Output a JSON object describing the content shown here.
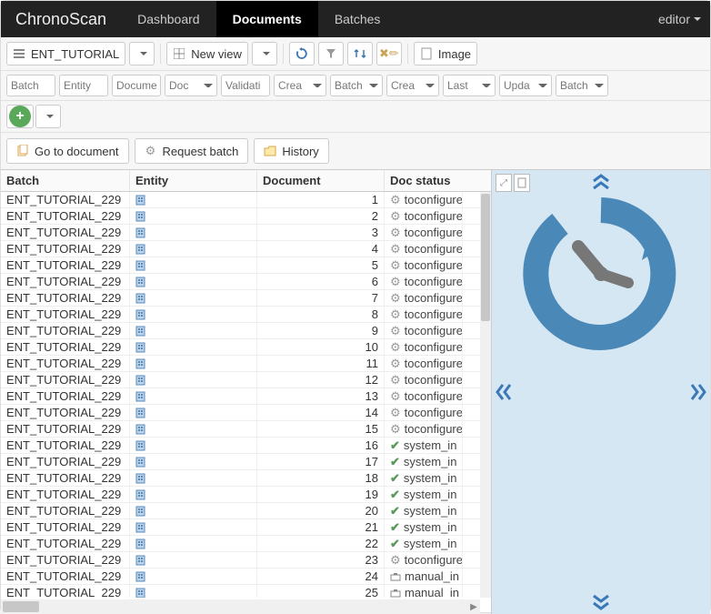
{
  "nav": {
    "brand": "ChronoScan",
    "items": [
      "Dashboard",
      "Documents",
      "Batches"
    ],
    "active_index": 1,
    "user": "editor"
  },
  "toolbar1": {
    "config_label": "ENT_TUTORIAL",
    "view_label": "New view",
    "image_btn": "Image"
  },
  "filters": {
    "f0": "Batch",
    "f1": "Entity",
    "f2": "Docume",
    "f3": "Doc",
    "f4": "Validati",
    "f5": "Crea",
    "f6": "Batch",
    "f7": "Crea",
    "f8": "Last",
    "f9": "Upda",
    "f10": "Batch"
  },
  "actions": {
    "goto": "Go to document",
    "request": "Request batch",
    "history": "History"
  },
  "grid": {
    "headers": {
      "batch": "Batch",
      "entity": "Entity",
      "document": "Document",
      "status": "Doc status"
    },
    "rows": [
      {
        "batch": "ENT_TUTORIAL_229",
        "doc": 1,
        "status": "toconfigure",
        "kind": "cfg"
      },
      {
        "batch": "ENT_TUTORIAL_229",
        "doc": 2,
        "status": "toconfigure",
        "kind": "cfg"
      },
      {
        "batch": "ENT_TUTORIAL_229",
        "doc": 3,
        "status": "toconfigure",
        "kind": "cfg"
      },
      {
        "batch": "ENT_TUTORIAL_229",
        "doc": 4,
        "status": "toconfigure",
        "kind": "cfg"
      },
      {
        "batch": "ENT_TUTORIAL_229",
        "doc": 5,
        "status": "toconfigure",
        "kind": "cfg"
      },
      {
        "batch": "ENT_TUTORIAL_229",
        "doc": 6,
        "status": "toconfigure",
        "kind": "cfg"
      },
      {
        "batch": "ENT_TUTORIAL_229",
        "doc": 7,
        "status": "toconfigure",
        "kind": "cfg"
      },
      {
        "batch": "ENT_TUTORIAL_229",
        "doc": 8,
        "status": "toconfigure",
        "kind": "cfg"
      },
      {
        "batch": "ENT_TUTORIAL_229",
        "doc": 9,
        "status": "toconfigure",
        "kind": "cfg"
      },
      {
        "batch": "ENT_TUTORIAL_229",
        "doc": 10,
        "status": "toconfigure",
        "kind": "cfg"
      },
      {
        "batch": "ENT_TUTORIAL_229",
        "doc": 11,
        "status": "toconfigure",
        "kind": "cfg"
      },
      {
        "batch": "ENT_TUTORIAL_229",
        "doc": 12,
        "status": "toconfigure",
        "kind": "cfg"
      },
      {
        "batch": "ENT_TUTORIAL_229",
        "doc": 13,
        "status": "toconfigure",
        "kind": "cfg"
      },
      {
        "batch": "ENT_TUTORIAL_229",
        "doc": 14,
        "status": "toconfigure",
        "kind": "cfg"
      },
      {
        "batch": "ENT_TUTORIAL_229",
        "doc": 15,
        "status": "toconfigure",
        "kind": "cfg"
      },
      {
        "batch": "ENT_TUTORIAL_229",
        "doc": 16,
        "status": "system_in",
        "kind": "ok"
      },
      {
        "batch": "ENT_TUTORIAL_229",
        "doc": 17,
        "status": "system_in",
        "kind": "ok"
      },
      {
        "batch": "ENT_TUTORIAL_229",
        "doc": 18,
        "status": "system_in",
        "kind": "ok"
      },
      {
        "batch": "ENT_TUTORIAL_229",
        "doc": 19,
        "status": "system_in",
        "kind": "ok"
      },
      {
        "batch": "ENT_TUTORIAL_229",
        "doc": 20,
        "status": "system_in",
        "kind": "ok"
      },
      {
        "batch": "ENT_TUTORIAL_229",
        "doc": 21,
        "status": "system_in",
        "kind": "ok"
      },
      {
        "batch": "ENT_TUTORIAL_229",
        "doc": 22,
        "status": "system_in",
        "kind": "ok"
      },
      {
        "batch": "ENT_TUTORIAL_229",
        "doc": 23,
        "status": "toconfigure",
        "kind": "cfg"
      },
      {
        "batch": "ENT_TUTORIAL_229",
        "doc": 24,
        "status": "manual_in",
        "kind": "man"
      },
      {
        "batch": "ENT_TUTORIAL_229",
        "doc": 25,
        "status": "manual_in",
        "kind": "man"
      }
    ]
  }
}
